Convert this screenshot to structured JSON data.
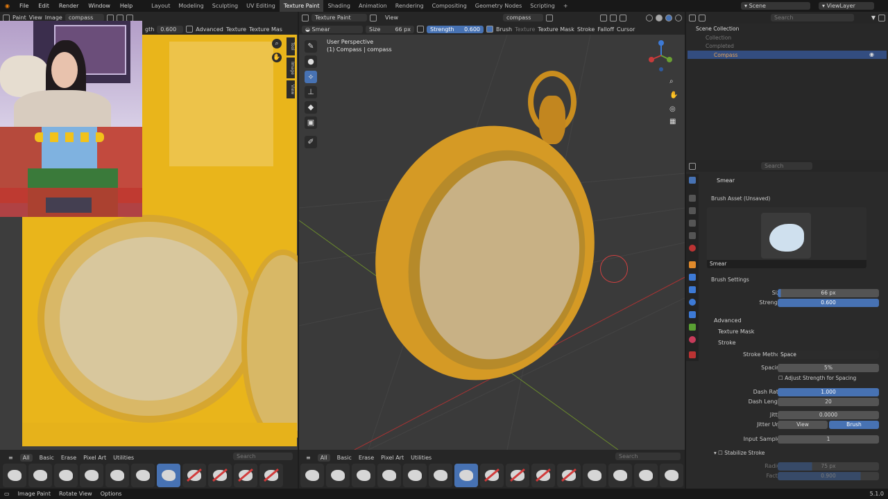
{
  "menu": [
    "File",
    "Edit",
    "Render",
    "Window",
    "Help"
  ],
  "workspaces": [
    "Layout",
    "Modeling",
    "Sculpting",
    "UV Editing",
    "Texture Paint",
    "Shading",
    "Animation",
    "Rendering",
    "Compositing",
    "Geometry Nodes",
    "Scripting"
  ],
  "active_workspace": "Texture Paint",
  "scene": "Scene",
  "view_layer": "ViewLayer",
  "image_editor": {
    "mode": "Paint",
    "view": "View",
    "image_menu": "Image",
    "image_name": "compass",
    "strength_label": "gth",
    "strength": "0.600",
    "advanced": "Advanced",
    "texture": "Texture",
    "texture_mask": "Texture Mas",
    "side_tabs": [
      "Tool",
      "Image",
      "View"
    ]
  },
  "viewport_header": {
    "mode": "Texture Paint",
    "view": "View",
    "object": "compass",
    "brush": "Smear",
    "size_label": "Size",
    "size": "66 px",
    "strength_label": "Strength",
    "strength": "0.600",
    "menus": [
      "Brush",
      "Texture",
      "Texture Mask",
      "Stroke",
      "Falloff",
      "Cursor"
    ]
  },
  "viewport": {
    "perspective": "User Perspective",
    "object_info": "(1) Compass | compass"
  },
  "outliner": {
    "search_placeholder": "Search",
    "root": "Scene Collection",
    "items": [
      "Collection",
      "Completed",
      "Compass"
    ]
  },
  "properties": {
    "search_placeholder": "Search",
    "brush_name": "Smear",
    "brush_asset": "Brush Asset (Unsaved)",
    "asset_name": "Smear",
    "brush_settings": "Brush Settings",
    "size_label": "Size",
    "size": "66 px",
    "strength_label": "Strength",
    "strength": "0.600",
    "advanced": "Advanced",
    "texture_mask": "Texture Mask",
    "stroke": "Stroke",
    "stroke_method_label": "Stroke Method",
    "stroke_method": "Space",
    "spacing_label": "Spacing",
    "spacing": "5%",
    "adjust_strength": "Adjust Strength for Spacing",
    "dash_ratio_label": "Dash Ratio",
    "dash_ratio": "1.000",
    "dash_length_label": "Dash Length",
    "dash_length": "20",
    "jitter_label": "Jitter",
    "jitter": "0.0000",
    "jitter_unit_label": "Jitter Unit",
    "jitter_unit_options": [
      "View",
      "Brush"
    ],
    "jitter_unit_selected": "Brush",
    "input_samples_label": "Input Samples",
    "input_samples": "1",
    "stabilize_stroke": "Stabilize Stroke",
    "radius_label": "Radius",
    "radius": "75 px",
    "factor_label": "Factor",
    "factor": "0.900"
  },
  "shelf": {
    "tabs": [
      "All",
      "Basic",
      "Erase",
      "Pixel Art",
      "Utilities"
    ],
    "search_placeholder": "Search"
  },
  "status": {
    "items": [
      "Image Paint",
      "Rotate View",
      "Options"
    ],
    "version": "5.1.0"
  },
  "colors": {
    "accent": "#4772b3",
    "gold": "#e9b51b"
  }
}
